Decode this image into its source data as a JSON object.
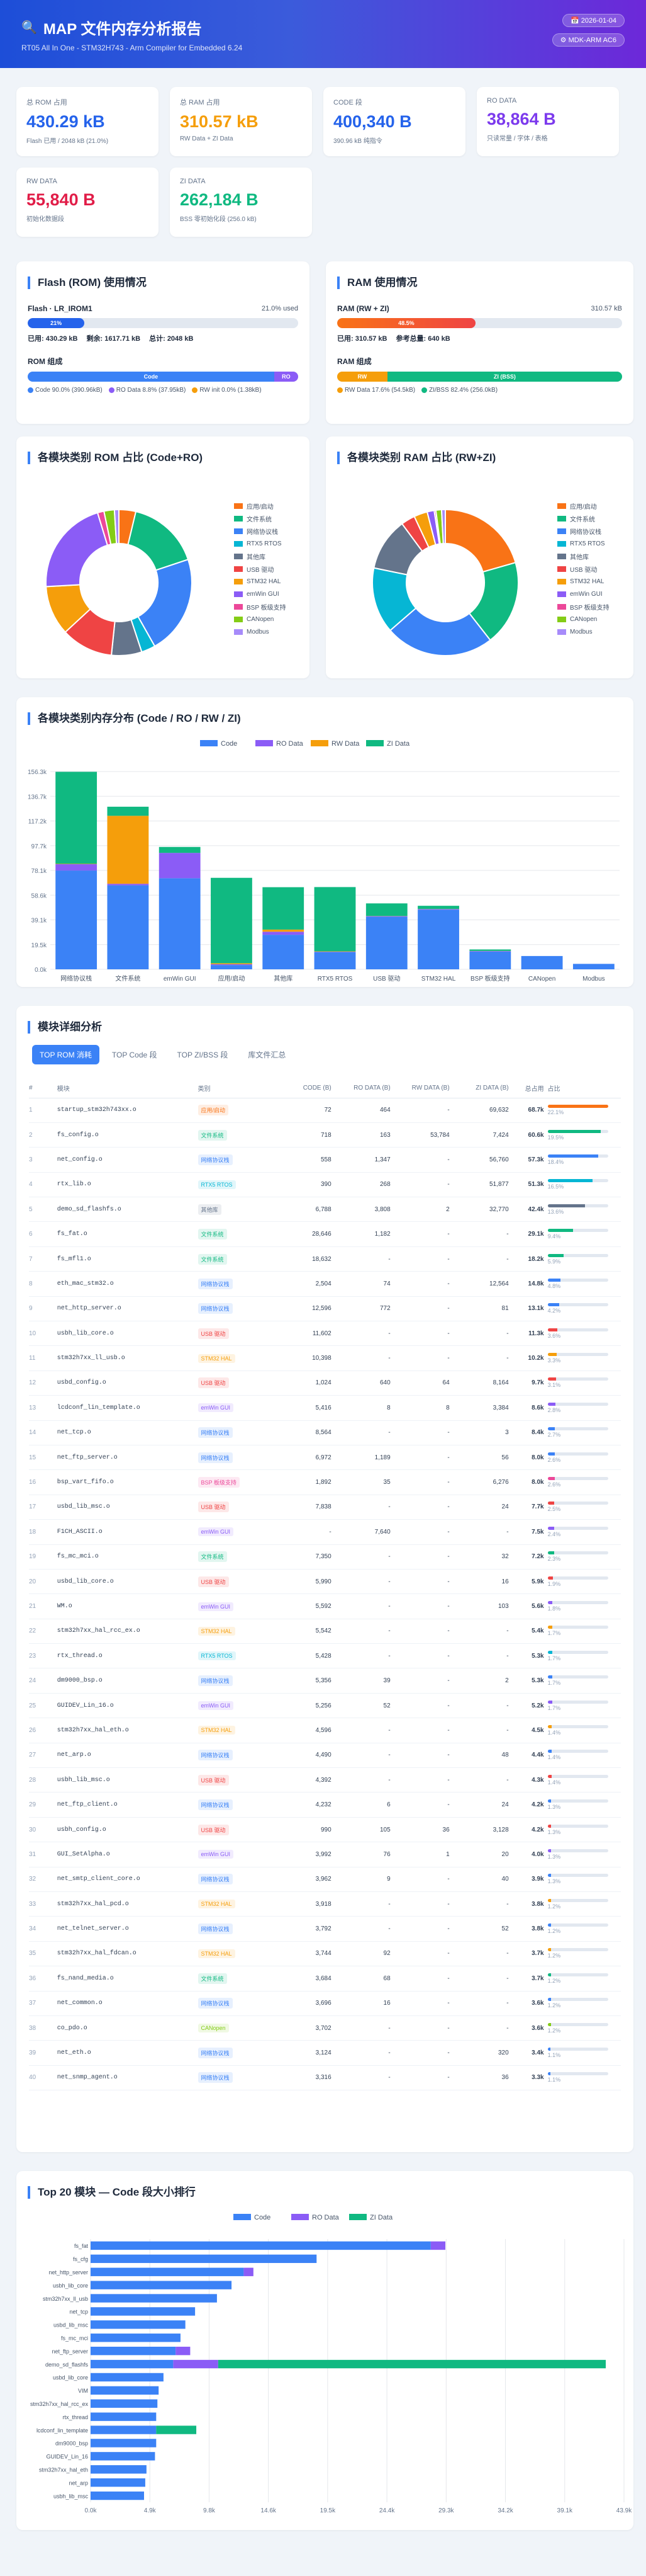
{
  "header": {
    "title": "MAP 文件内存分析报告",
    "subtitle": "RT05 All In One - STM32H743 - Arm Compiler for Embedded 6.24",
    "date": "2026-01-04",
    "toolchain": "MDK-ARM AC6"
  },
  "cards": [
    {
      "label": "总 ROM 占用",
      "value": "430.29 kB",
      "note": "Flash 已用 / 2048 kB (21.0%)",
      "color": "#2563eb"
    },
    {
      "label": "总 RAM 占用",
      "value": "310.57 kB",
      "note": "RW Data + ZI Data",
      "color": "#f59e0b"
    },
    {
      "label": "CODE 段",
      "value": "400,340 B",
      "note": "390.96 kB 纯指令",
      "color": "#2563eb"
    },
    {
      "label": "RO DATA",
      "value": "38,864 B",
      "note": "只读常量 / 字体 / 表格",
      "color": "#7c3aed"
    },
    {
      "label": "RW DATA",
      "value": "55,840 B",
      "note": "初始化数据段",
      "color": "#e11d48"
    },
    {
      "label": "ZI DATA",
      "value": "262,184 B",
      "note": "BSS 零初始化段 (256.0 kB)",
      "color": "#10b981"
    }
  ],
  "flash": {
    "title": "Flash (ROM) 使用情况",
    "name": "Flash · LR_IROM1",
    "used_label": "21.0% used",
    "pct": 21.0,
    "bar_label": "21%",
    "used": "已用: 430.29 kB",
    "free": "剩余: 1617.71 kB",
    "total": "总计: 2048 kB",
    "comp_title": "ROM 组成",
    "code_pct": 91.1,
    "ro_pct": 8.9,
    "code_seg": "Code",
    "ro_seg": "RO",
    "legend": [
      "Code 90.0% (390.96kB)",
      "RO Data 8.8% (37.95kB)",
      "RW init 0.0% (1.38kB)"
    ]
  },
  "ram": {
    "title": "RAM 使用情况",
    "name": "RAM (RW + ZI)",
    "used_label": "310.57 kB",
    "pct": 48.5,
    "bar_label": "48.5%",
    "used": "已用: 310.57 kB",
    "ref": "参考总量: 640 kB",
    "comp_title": "RAM 组成",
    "rw_pct": 17.6,
    "zi_pct": 82.4,
    "rw_seg": "RW",
    "zi_seg": "ZI (BSS)",
    "legend": [
      "RW Data 17.6% (54.5kB)",
      "ZI/BSS 82.4% (256.0kB)"
    ]
  },
  "pie_rom": {
    "title": "各模块类别 ROM 占比 (Code+RO)",
    "legend": [
      "应用/启动",
      "文件系统",
      "网络协议栈",
      "RTX5 RTOS",
      "其他库",
      "USB 驱动",
      "STM32 HAL",
      "emWin GUI",
      "BSP 板级支持",
      "CANopen",
      "Modbus"
    ],
    "colors": [
      "#f97316",
      "#10b981",
      "#3b82f6",
      "#06b6d4",
      "#64748b",
      "#ef4444",
      "#f59e0b",
      "#8b5cf6",
      "#ec4899",
      "#84cc16",
      "#a78bfa"
    ],
    "values": [
      16.4,
      70.6,
      96.1,
      13.6,
      29.4,
      50.3,
      48.1,
      92.6,
      6.3,
      10.1,
      4.3
    ]
  },
  "pie_ram": {
    "title": "各模块类别 RAM 占比 (RW+ZI)",
    "legend": [
      "应用/启动",
      "文件系统",
      "网络协议栈",
      "RTX5 RTOS",
      "其他库",
      "USB 驱动",
      "STM32 HAL",
      "emWin GUI",
      "BSP 板级支持",
      "CANopen",
      "Modbus"
    ],
    "colors": [
      "#f97316",
      "#10b981",
      "#3b82f6",
      "#06b6d4",
      "#64748b",
      "#ef4444",
      "#f59e0b",
      "#8b5cf6",
      "#ec4899",
      "#84cc16",
      "#a78bfa"
    ],
    "values": [
      62.1,
      56.9,
      73.0,
      44.0,
      35.2,
      9.4,
      9.0,
      4.7,
      1.1,
      3.8,
      2.5
    ]
  },
  "chart_data": [
    {
      "type": "bar",
      "title": "各模块类别内存分布 (Code / RO / RW / ZI)",
      "categories": [
        "网络协议栈",
        "文件系统",
        "emWin GUI",
        "应用/启动",
        "其他库",
        "RTX5 RTOS",
        "USB 驱动",
        "STM32 HAL",
        "BSP 板级支持",
        "CANopen",
        "Modbus"
      ],
      "y_ticks": [
        "0.0k",
        "19.5k",
        "39.1k",
        "58.6k",
        "78.1k",
        "97.7k",
        "117.2k",
        "136.7k",
        "156.3k"
      ],
      "ylim": [
        0,
        156.3
      ],
      "series": [
        {
          "name": "Code",
          "color": "#3b82f6",
          "values": [
            78.1,
            66.4,
            72.0,
            3.4,
            27.3,
            13.6,
            41.5,
            47.1,
            14.0,
            10.5,
            4.3
          ]
        },
        {
          "name": "RO Data",
          "color": "#8b5cf6",
          "values": [
            5.0,
            1.2,
            20.0,
            0.6,
            2.4,
            0.3,
            0.5,
            0.5,
            0.4,
            0,
            0
          ]
        },
        {
          "name": "RW Data",
          "color": "#f59e0b",
          "values": [
            0.3,
            53.7,
            0,
            0.8,
            1.7,
            0.3,
            0.1,
            0.1,
            0.1,
            0,
            0
          ]
        },
        {
          "name": "ZI Data",
          "color": "#10b981",
          "values": [
            72.7,
            7.2,
            4.7,
            67.5,
            33.5,
            50.8,
            10.0,
            2.5,
            1.2,
            0,
            0
          ]
        }
      ]
    },
    {
      "type": "bar",
      "title": "Top 20 模块 — Code 段大小排行",
      "orientation": "horizontal",
      "categories": [
        "fs_fat",
        "fs_cfg",
        "net_http_server",
        "usbh_lib_core",
        "stm32h7xx_ll_usb",
        "net_tcp",
        "usbd_lib_msc",
        "fs_mc_mci",
        "net_ftp_server",
        "demo_sd_flashfs",
        "usbd_lib_core",
        "VIM",
        "stm32h7xx_hal_rcc_ex",
        "rtx_thread",
        "lcdconf_lin_template",
        "dm9000_bsp",
        "GUIDEV_Lin_16",
        "stm32h7xx_hal_eth",
        "net_arp",
        "usbh_lib_msc"
      ],
      "x_ticks": [
        "0.0k",
        "4.9k",
        "9.8k",
        "14.6k",
        "19.5k",
        "24.4k",
        "29.3k",
        "34.2k",
        "39.1k",
        "43.9k"
      ],
      "xlim": [
        0,
        43.9
      ],
      "series": [
        {
          "name": "Code",
          "color": "#3b82f6",
          "values": [
            28.0,
            18.6,
            12.6,
            11.6,
            10.4,
            8.6,
            7.8,
            7.4,
            7.0,
            6.8,
            6.0,
            5.6,
            5.5,
            5.4,
            5.4,
            5.4,
            5.3,
            4.6,
            4.5,
            4.4
          ]
        },
        {
          "name": "RO Data",
          "color": "#8b5cf6",
          "values": [
            1.2,
            0,
            0.8,
            0,
            0,
            0,
            0,
            0,
            1.2,
            3.7,
            0,
            0,
            0,
            0,
            0,
            0,
            0,
            0,
            0,
            0
          ]
        },
        {
          "name": "ZI Data",
          "color": "#10b981",
          "values": [
            0,
            0,
            0,
            0,
            0,
            0,
            0,
            0,
            0,
            31.9,
            0,
            0,
            0,
            0,
            3.3,
            0,
            0,
            0,
            0,
            0
          ]
        }
      ]
    }
  ],
  "table": {
    "title": "模块详细分析",
    "tabs": [
      "TOP ROM 消耗",
      "TOP Code 段",
      "TOP ZI/BSS 段",
      "库文件汇总"
    ],
    "headers": [
      "#",
      "模块",
      "类别",
      "CODE (B)",
      "RO DATA (B)",
      "RW DATA (B)",
      "ZI DATA (B)",
      "总占用",
      "占比"
    ],
    "rows": [
      [
        "1",
        "startup_stm32h743xx.o",
        "应用/启动",
        "72",
        "464",
        "-",
        "69,632",
        "68.7k",
        "22.1%",
        "#f97316"
      ],
      [
        "2",
        "fs_config.o",
        "文件系统",
        "718",
        "163",
        "53,784",
        "7,424",
        "60.6k",
        "19.5%",
        "#10b981"
      ],
      [
        "3",
        "net_config.o",
        "网络协议栈",
        "558",
        "1,347",
        "-",
        "56,760",
        "57.3k",
        "18.4%",
        "#3b82f6"
      ],
      [
        "4",
        "rtx_lib.o",
        "RTX5 RTOS",
        "390",
        "268",
        "-",
        "51,877",
        "51.3k",
        "16.5%",
        "#06b6d4"
      ],
      [
        "5",
        "demo_sd_flashfs.o",
        "其他库",
        "6,788",
        "3,808",
        "2",
        "32,770",
        "42.4k",
        "13.6%",
        "#64748b"
      ],
      [
        "6",
        "fs_fat.o",
        "文件系统",
        "28,646",
        "1,182",
        "-",
        "-",
        "29.1k",
        "9.4%",
        "#10b981"
      ],
      [
        "7",
        "fs_mfl1.o",
        "文件系统",
        "18,632",
        "-",
        "-",
        "-",
        "18.2k",
        "5.9%",
        "#10b981"
      ],
      [
        "8",
        "eth_mac_stm32.o",
        "网络协议栈",
        "2,504",
        "74",
        "-",
        "12,564",
        "14.8k",
        "4.8%",
        "#3b82f6"
      ],
      [
        "9",
        "net_http_server.o",
        "网络协议栈",
        "12,596",
        "772",
        "-",
        "81",
        "13.1k",
        "4.2%",
        "#3b82f6"
      ],
      [
        "10",
        "usbh_lib_core.o",
        "USB 驱动",
        "11,602",
        "-",
        "-",
        "-",
        "11.3k",
        "3.6%",
        "#ef4444"
      ],
      [
        "11",
        "stm32h7xx_ll_usb.o",
        "STM32 HAL",
        "10,398",
        "-",
        "-",
        "-",
        "10.2k",
        "3.3%",
        "#f59e0b"
      ],
      [
        "12",
        "usbd_config.o",
        "USB 驱动",
        "1,024",
        "640",
        "64",
        "8,164",
        "9.7k",
        "3.1%",
        "#ef4444"
      ],
      [
        "13",
        "lcdconf_lin_template.o",
        "emWin GUI",
        "5,416",
        "8",
        "8",
        "3,384",
        "8.6k",
        "2.8%",
        "#8b5cf6"
      ],
      [
        "14",
        "net_tcp.o",
        "网络协议栈",
        "8,564",
        "-",
        "-",
        "3",
        "8.4k",
        "2.7%",
        "#3b82f6"
      ],
      [
        "15",
        "net_ftp_server.o",
        "网络协议栈",
        "6,972",
        "1,189",
        "-",
        "56",
        "8.0k",
        "2.6%",
        "#3b82f6"
      ],
      [
        "16",
        "bsp_vart_fifo.o",
        "BSP 板级支持",
        "1,892",
        "35",
        "-",
        "6,276",
        "8.0k",
        "2.6%",
        "#ec4899"
      ],
      [
        "17",
        "usbd_lib_msc.o",
        "USB 驱动",
        "7,838",
        "-",
        "-",
        "24",
        "7.7k",
        "2.5%",
        "#ef4444"
      ],
      [
        "18",
        "F1CH_ASCII.o",
        "emWin GUI",
        "-",
        "7,640",
        "-",
        "-",
        "7.5k",
        "2.4%",
        "#8b5cf6"
      ],
      [
        "19",
        "fs_mc_mci.o",
        "文件系统",
        "7,350",
        "-",
        "-",
        "32",
        "7.2k",
        "2.3%",
        "#10b981"
      ],
      [
        "20",
        "usbd_lib_core.o",
        "USB 驱动",
        "5,990",
        "-",
        "-",
        "16",
        "5.9k",
        "1.9%",
        "#ef4444"
      ],
      [
        "21",
        "WM.o",
        "emWin GUI",
        "5,592",
        "-",
        "-",
        "103",
        "5.6k",
        "1.8%",
        "#8b5cf6"
      ],
      [
        "22",
        "stm32h7xx_hal_rcc_ex.o",
        "STM32 HAL",
        "5,542",
        "-",
        "-",
        "-",
        "5.4k",
        "1.7%",
        "#f59e0b"
      ],
      [
        "23",
        "rtx_thread.o",
        "RTX5 RTOS",
        "5,428",
        "-",
        "-",
        "-",
        "5.3k",
        "1.7%",
        "#06b6d4"
      ],
      [
        "24",
        "dm9000_bsp.o",
        "网络协议栈",
        "5,356",
        "39",
        "-",
        "2",
        "5.3k",
        "1.7%",
        "#3b82f6"
      ],
      [
        "25",
        "GUIDEV_Lin_16.o",
        "emWin GUI",
        "5,256",
        "52",
        "-",
        "-",
        "5.2k",
        "1.7%",
        "#8b5cf6"
      ],
      [
        "26",
        "stm32h7xx_hal_eth.o",
        "STM32 HAL",
        "4,596",
        "-",
        "-",
        "-",
        "4.5k",
        "1.4%",
        "#f59e0b"
      ],
      [
        "27",
        "net_arp.o",
        "网络协议栈",
        "4,490",
        "-",
        "-",
        "48",
        "4.4k",
        "1.4%",
        "#3b82f6"
      ],
      [
        "28",
        "usbh_lib_msc.o",
        "USB 驱动",
        "4,392",
        "-",
        "-",
        "-",
        "4.3k",
        "1.4%",
        "#ef4444"
      ],
      [
        "29",
        "net_ftp_client.o",
        "网络协议栈",
        "4,232",
        "6",
        "-",
        "24",
        "4.2k",
        "1.3%",
        "#3b82f6"
      ],
      [
        "30",
        "usbh_config.o",
        "USB 驱动",
        "990",
        "105",
        "36",
        "3,128",
        "4.2k",
        "1.3%",
        "#ef4444"
      ],
      [
        "31",
        "GUI_SetAlpha.o",
        "emWin GUI",
        "3,992",
        "76",
        "1",
        "20",
        "4.0k",
        "1.3%",
        "#8b5cf6"
      ],
      [
        "32",
        "net_smtp_client_core.o",
        "网络协议栈",
        "3,962",
        "9",
        "-",
        "40",
        "3.9k",
        "1.3%",
        "#3b82f6"
      ],
      [
        "33",
        "stm32h7xx_hal_pcd.o",
        "STM32 HAL",
        "3,918",
        "-",
        "-",
        "-",
        "3.8k",
        "1.2%",
        "#f59e0b"
      ],
      [
        "34",
        "net_telnet_server.o",
        "网络协议栈",
        "3,792",
        "-",
        "-",
        "52",
        "3.8k",
        "1.2%",
        "#3b82f6"
      ],
      [
        "35",
        "stm32h7xx_hal_fdcan.o",
        "STM32 HAL",
        "3,744",
        "92",
        "-",
        "-",
        "3.7k",
        "1.2%",
        "#f59e0b"
      ],
      [
        "36",
        "fs_nand_media.o",
        "文件系统",
        "3,684",
        "68",
        "-",
        "-",
        "3.7k",
        "1.2%",
        "#10b981"
      ],
      [
        "37",
        "net_common.o",
        "网络协议栈",
        "3,696",
        "16",
        "-",
        "-",
        "3.6k",
        "1.2%",
        "#3b82f6"
      ],
      [
        "38",
        "co_pdo.o",
        "CANopen",
        "3,702",
        "-",
        "-",
        "-",
        "3.6k",
        "1.2%",
        "#84cc16"
      ],
      [
        "39",
        "net_eth.o",
        "网络协议栈",
        "3,124",
        "-",
        "-",
        "320",
        "3.4k",
        "1.1%",
        "#3b82f6"
      ],
      [
        "40",
        "net_snmp_agent.o",
        "网络协议栈",
        "3,316",
        "-",
        "-",
        "36",
        "3.3k",
        "1.1%",
        "#3b82f6"
      ]
    ]
  }
}
